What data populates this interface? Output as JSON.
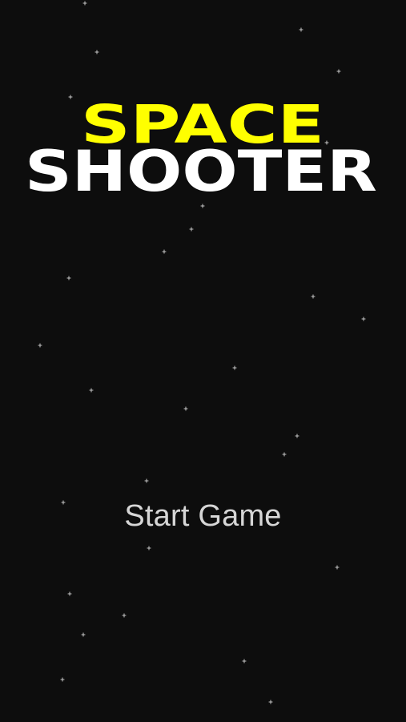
{
  "game": {
    "title_line1": "SPACE",
    "title_line2": "SHOOTER",
    "start_label": "Start Game"
  },
  "colors": {
    "background": "#0d0d0d",
    "title_line1": "#ffff00",
    "title_line2": "#ffffff",
    "start_label": "#d6d6d6",
    "stars": "#9a9a9a"
  }
}
